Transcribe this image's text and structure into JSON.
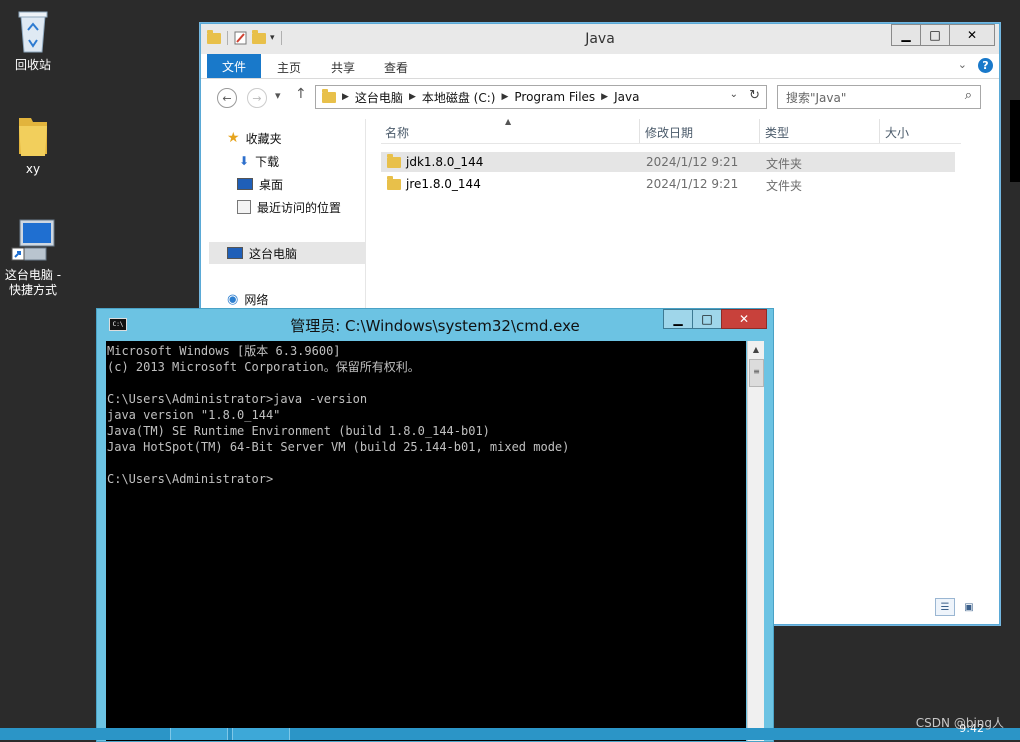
{
  "desktop": {
    "icons": [
      {
        "label": "回收站",
        "icon": "recycle-bin-icon"
      },
      {
        "label": "xy",
        "icon": "folder-icon"
      },
      {
        "label": "这台电脑 - 快捷方式",
        "icon": "computer-shortcut-icon"
      }
    ]
  },
  "explorer": {
    "title": "Java",
    "ribbon_tabs": [
      "文件",
      "主页",
      "共享",
      "查看"
    ],
    "address": {
      "crumbs": [
        "这台电脑",
        "本地磁盘 (C:)",
        "Program Files",
        "Java"
      ]
    },
    "search_placeholder": "搜索\"Java\"",
    "nav_pane": {
      "favorites": "收藏夹",
      "downloads": "下载",
      "desktop": "桌面",
      "recent": "最近访问的位置",
      "this_pc": "这台电脑",
      "network": "网络"
    },
    "columns": [
      "名称",
      "修改日期",
      "类型",
      "大小"
    ],
    "files": [
      {
        "name": "jdk1.8.0_144",
        "date": "2024/1/12 9:21",
        "type": "文件夹",
        "size": ""
      },
      {
        "name": "jre1.8.0_144",
        "date": "2024/1/12 9:21",
        "type": "文件夹",
        "size": ""
      }
    ]
  },
  "cmd": {
    "title": "管理员: C:\\Windows\\system32\\cmd.exe",
    "lines": [
      "Microsoft Windows [版本 6.3.9600]",
      "(c) 2013 Microsoft Corporation。保留所有权利。",
      "",
      "C:\\Users\\Administrator>java -version",
      "java version \"1.8.0_144\"",
      "Java(TM) SE Runtime Environment (build 1.8.0_144-b01)",
      "Java HotSpot(TM) 64-Bit Server VM (build 25.144-b01, mixed mode)",
      "",
      "C:\\Users\\Administrator>"
    ]
  },
  "taskbar": {
    "clock": "9:42"
  },
  "watermark": "CSDN @bing人"
}
